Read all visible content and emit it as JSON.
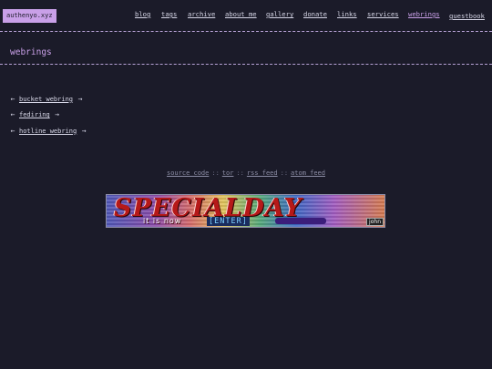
{
  "site": {
    "title": "authenyo.xyz"
  },
  "nav": [
    {
      "label": "blog"
    },
    {
      "label": "tags"
    },
    {
      "label": "archive"
    },
    {
      "label": "about me"
    },
    {
      "label": "gallery"
    },
    {
      "label": "donate"
    },
    {
      "label": "links"
    },
    {
      "label": "services"
    },
    {
      "label": "webrings"
    },
    {
      "label": "guestbook"
    }
  ],
  "page": {
    "title": "webrings"
  },
  "webrings": [
    {
      "prev": "←",
      "name": "bucket webring",
      "next": "→"
    },
    {
      "prev": "←",
      "name": "fediring",
      "next": "→"
    },
    {
      "prev": "←",
      "name": "hotline webring",
      "next": "→"
    }
  ],
  "footer": {
    "links": [
      {
        "label": "source code"
      },
      {
        "label": "tor"
      },
      {
        "label": "rss feed"
      },
      {
        "label": "atom feed"
      }
    ],
    "separator": "::"
  },
  "banner": {
    "title": "SPECIALDAY",
    "subtitle": "it is now",
    "enter": "[ENTER]",
    "badge": "john"
  },
  "colors": {
    "background": "#1b1b29",
    "accent": "#c9a0e8",
    "text": "#d6d6e6",
    "muted": "#8b8ca4"
  }
}
